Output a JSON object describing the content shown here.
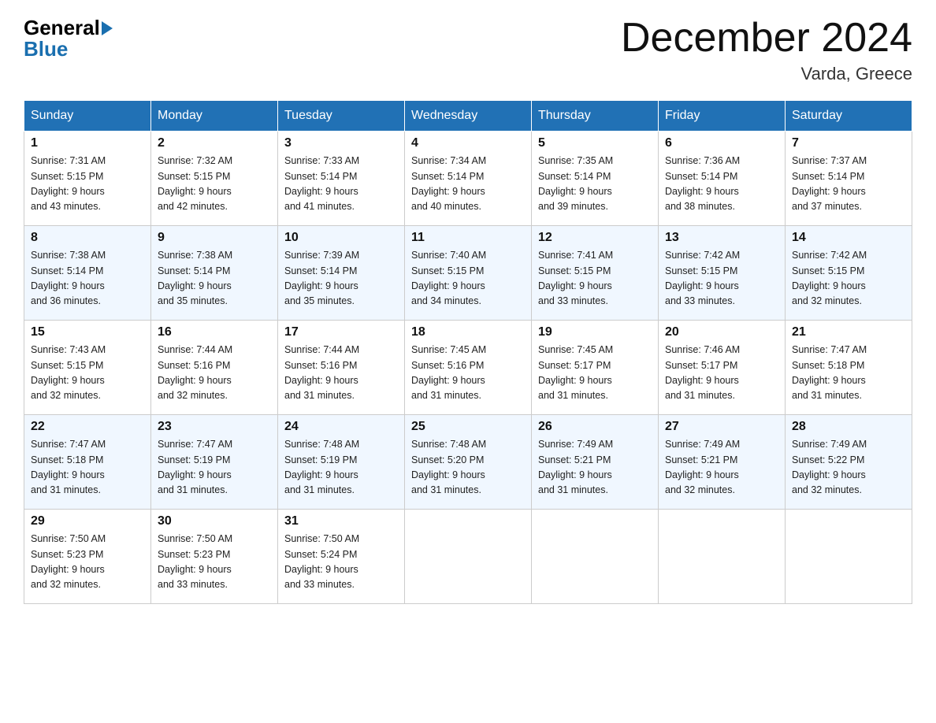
{
  "header": {
    "logo_general": "General",
    "logo_blue": "Blue",
    "title": "December 2024",
    "location": "Varda, Greece"
  },
  "days_of_week": [
    "Sunday",
    "Monday",
    "Tuesday",
    "Wednesday",
    "Thursday",
    "Friday",
    "Saturday"
  ],
  "weeks": [
    [
      {
        "num": "1",
        "sunrise": "7:31 AM",
        "sunset": "5:15 PM",
        "daylight": "9 hours and 43 minutes."
      },
      {
        "num": "2",
        "sunrise": "7:32 AM",
        "sunset": "5:15 PM",
        "daylight": "9 hours and 42 minutes."
      },
      {
        "num": "3",
        "sunrise": "7:33 AM",
        "sunset": "5:14 PM",
        "daylight": "9 hours and 41 minutes."
      },
      {
        "num": "4",
        "sunrise": "7:34 AM",
        "sunset": "5:14 PM",
        "daylight": "9 hours and 40 minutes."
      },
      {
        "num": "5",
        "sunrise": "7:35 AM",
        "sunset": "5:14 PM",
        "daylight": "9 hours and 39 minutes."
      },
      {
        "num": "6",
        "sunrise": "7:36 AM",
        "sunset": "5:14 PM",
        "daylight": "9 hours and 38 minutes."
      },
      {
        "num": "7",
        "sunrise": "7:37 AM",
        "sunset": "5:14 PM",
        "daylight": "9 hours and 37 minutes."
      }
    ],
    [
      {
        "num": "8",
        "sunrise": "7:38 AM",
        "sunset": "5:14 PM",
        "daylight": "9 hours and 36 minutes."
      },
      {
        "num": "9",
        "sunrise": "7:38 AM",
        "sunset": "5:14 PM",
        "daylight": "9 hours and 35 minutes."
      },
      {
        "num": "10",
        "sunrise": "7:39 AM",
        "sunset": "5:14 PM",
        "daylight": "9 hours and 35 minutes."
      },
      {
        "num": "11",
        "sunrise": "7:40 AM",
        "sunset": "5:15 PM",
        "daylight": "9 hours and 34 minutes."
      },
      {
        "num": "12",
        "sunrise": "7:41 AM",
        "sunset": "5:15 PM",
        "daylight": "9 hours and 33 minutes."
      },
      {
        "num": "13",
        "sunrise": "7:42 AM",
        "sunset": "5:15 PM",
        "daylight": "9 hours and 33 minutes."
      },
      {
        "num": "14",
        "sunrise": "7:42 AM",
        "sunset": "5:15 PM",
        "daylight": "9 hours and 32 minutes."
      }
    ],
    [
      {
        "num": "15",
        "sunrise": "7:43 AM",
        "sunset": "5:15 PM",
        "daylight": "9 hours and 32 minutes."
      },
      {
        "num": "16",
        "sunrise": "7:44 AM",
        "sunset": "5:16 PM",
        "daylight": "9 hours and 32 minutes."
      },
      {
        "num": "17",
        "sunrise": "7:44 AM",
        "sunset": "5:16 PM",
        "daylight": "9 hours and 31 minutes."
      },
      {
        "num": "18",
        "sunrise": "7:45 AM",
        "sunset": "5:16 PM",
        "daylight": "9 hours and 31 minutes."
      },
      {
        "num": "19",
        "sunrise": "7:45 AM",
        "sunset": "5:17 PM",
        "daylight": "9 hours and 31 minutes."
      },
      {
        "num": "20",
        "sunrise": "7:46 AM",
        "sunset": "5:17 PM",
        "daylight": "9 hours and 31 minutes."
      },
      {
        "num": "21",
        "sunrise": "7:47 AM",
        "sunset": "5:18 PM",
        "daylight": "9 hours and 31 minutes."
      }
    ],
    [
      {
        "num": "22",
        "sunrise": "7:47 AM",
        "sunset": "5:18 PM",
        "daylight": "9 hours and 31 minutes."
      },
      {
        "num": "23",
        "sunrise": "7:47 AM",
        "sunset": "5:19 PM",
        "daylight": "9 hours and 31 minutes."
      },
      {
        "num": "24",
        "sunrise": "7:48 AM",
        "sunset": "5:19 PM",
        "daylight": "9 hours and 31 minutes."
      },
      {
        "num": "25",
        "sunrise": "7:48 AM",
        "sunset": "5:20 PM",
        "daylight": "9 hours and 31 minutes."
      },
      {
        "num": "26",
        "sunrise": "7:49 AM",
        "sunset": "5:21 PM",
        "daylight": "9 hours and 31 minutes."
      },
      {
        "num": "27",
        "sunrise": "7:49 AM",
        "sunset": "5:21 PM",
        "daylight": "9 hours and 32 minutes."
      },
      {
        "num": "28",
        "sunrise": "7:49 AM",
        "sunset": "5:22 PM",
        "daylight": "9 hours and 32 minutes."
      }
    ],
    [
      {
        "num": "29",
        "sunrise": "7:50 AM",
        "sunset": "5:23 PM",
        "daylight": "9 hours and 32 minutes."
      },
      {
        "num": "30",
        "sunrise": "7:50 AM",
        "sunset": "5:23 PM",
        "daylight": "9 hours and 33 minutes."
      },
      {
        "num": "31",
        "sunrise": "7:50 AM",
        "sunset": "5:24 PM",
        "daylight": "9 hours and 33 minutes."
      },
      null,
      null,
      null,
      null
    ]
  ],
  "labels": {
    "sunrise_prefix": "Sunrise: ",
    "sunset_prefix": "Sunset: ",
    "daylight_prefix": "Daylight: "
  }
}
